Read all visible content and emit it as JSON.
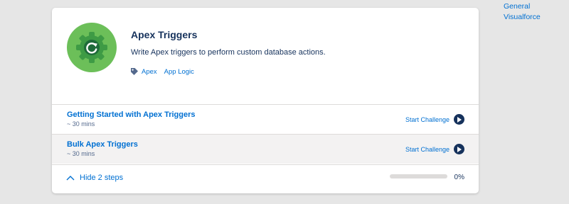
{
  "side_links": [
    "General",
    "Visualforce"
  ],
  "module": {
    "badge_icon": "gear-refresh-badge",
    "title": "Apex Triggers",
    "description": "Write Apex triggers to perform custom database actions.",
    "tags": [
      "Apex",
      "App Logic"
    ]
  },
  "steps": [
    {
      "title": "Getting Started with Apex Triggers",
      "time": "~ 30 mins",
      "action": "Start Challenge"
    },
    {
      "title": "Bulk Apex Triggers",
      "time": "~ 30 mins",
      "action": "Start Challenge"
    }
  ],
  "footer": {
    "toggle_label": "Hide 2 steps",
    "progress_percent": 0,
    "progress_text": "0%"
  },
  "colors": {
    "link": "#0070d2",
    "badge_green": "#6cbf59",
    "navy": "#16325c"
  }
}
